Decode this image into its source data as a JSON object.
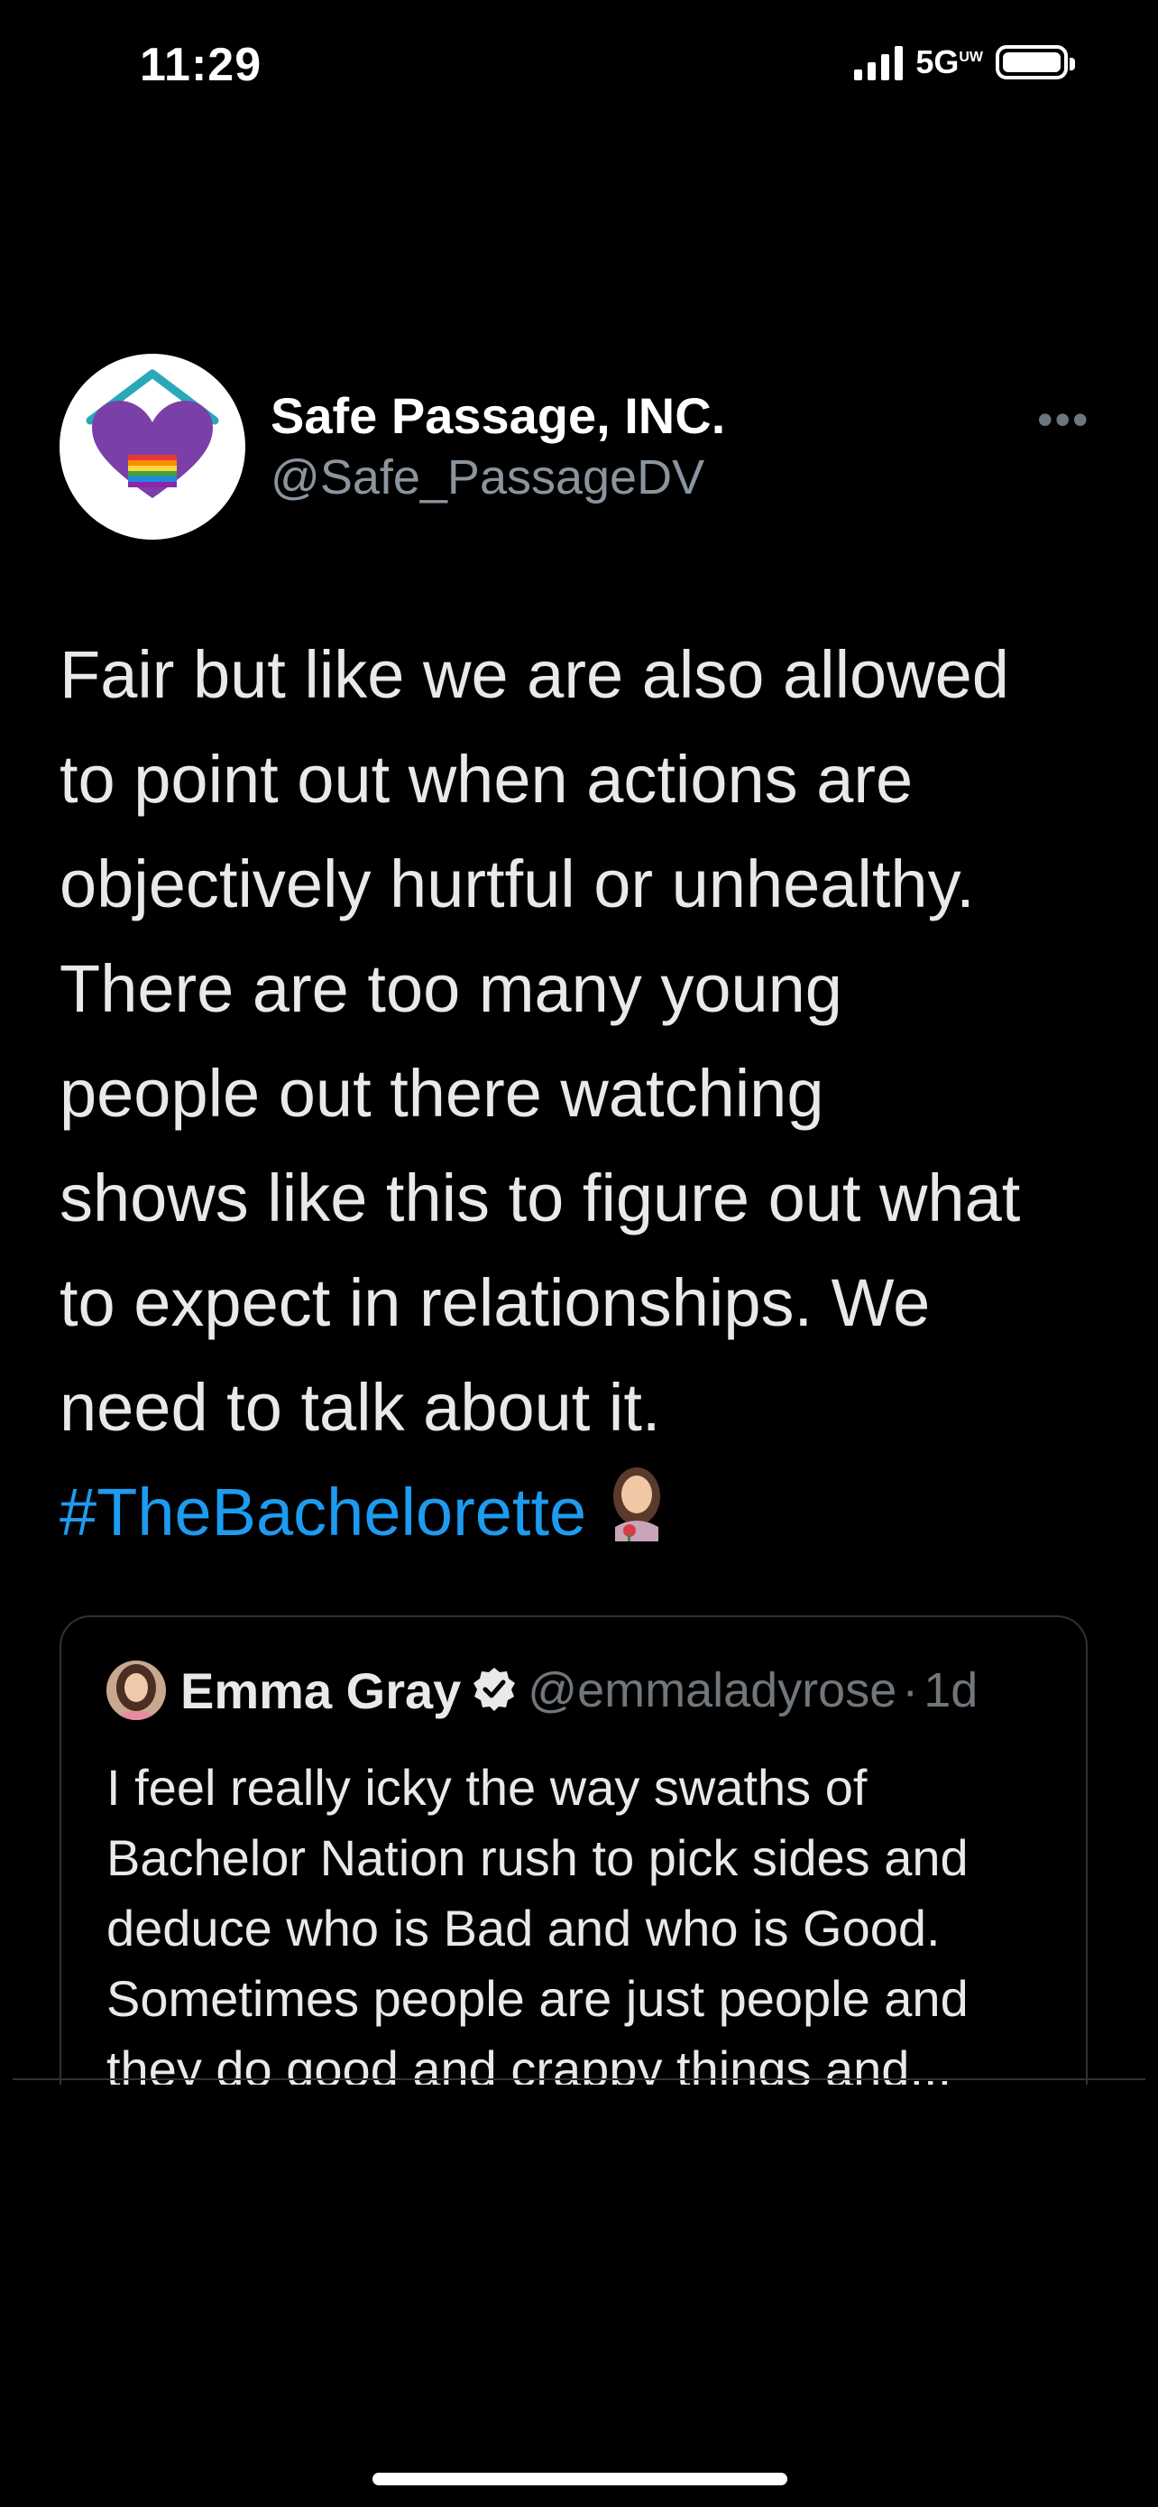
{
  "status_bar": {
    "time": "11:29",
    "network": "5G",
    "network_sub": "UW"
  },
  "tweet": {
    "author": {
      "display_name": "Safe Passage, INC.",
      "handle": "@Safe_PassageDV",
      "avatar": "house-heart-rainbow-logo"
    },
    "more_label": "•••",
    "text_lines": [
      "Fair but like we are also allowed",
      "to point out when actions are",
      "objectively hurtful or unhealthy.",
      "There are too many young",
      "people out there watching",
      "shows like this to figure out what",
      "to expect in relationships. We",
      "need to talk about it."
    ],
    "hashtag": "#TheBachelorette",
    "hashtag_emoji": "bachelorette-emoji"
  },
  "quoted_tweet": {
    "author": {
      "display_name": "Emma Gray",
      "handle": "@emmaladyrose",
      "verified": true
    },
    "separator": "·",
    "time": "1d",
    "text_lines": [
      "I feel really icky the way swaths of",
      "Bachelor Nation rush to pick sides and",
      "deduce who is Bad and who is Good.",
      "Sometimes people are just people and",
      "they do good and crappy things and..."
    ]
  },
  "colors": {
    "background": "#000000",
    "text": "#e7e9ea",
    "secondary": "#8b949e",
    "link": "#1d9bf0",
    "border": "#2f3336"
  }
}
